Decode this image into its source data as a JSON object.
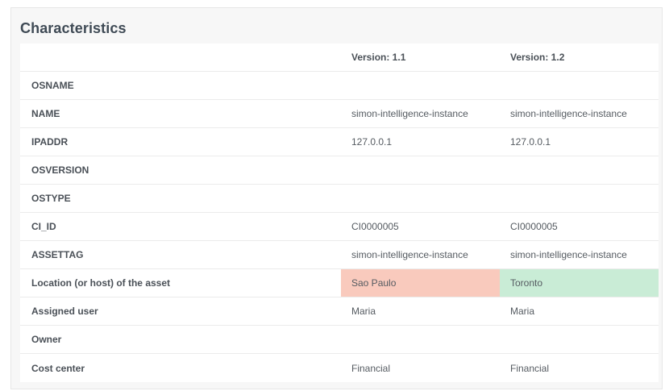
{
  "panel": {
    "title": "Characteristics"
  },
  "columns": {
    "v1": "Version: 1.1",
    "v2": "Version: 1.2"
  },
  "rows": [
    {
      "label": "OSNAME",
      "v1": "",
      "v2": ""
    },
    {
      "label": "NAME",
      "v1": "simon-intelligence-instance",
      "v2": "simon-intelligence-instance"
    },
    {
      "label": "IPADDR",
      "v1": "127.0.0.1",
      "v2": "127.0.0.1"
    },
    {
      "label": "OSVERSION",
      "v1": "",
      "v2": ""
    },
    {
      "label": "OSTYPE",
      "v1": "",
      "v2": ""
    },
    {
      "label": "CI_ID",
      "v1": "CI0000005",
      "v2": "CI0000005"
    },
    {
      "label": "ASSETTAG",
      "v1": "simon-intelligence-instance",
      "v2": "simon-intelligence-instance"
    },
    {
      "label": "Location (or host) of the asset",
      "v1": "Sao Paulo",
      "v2": "Toronto"
    },
    {
      "label": "Assigned user",
      "v1": "Maria",
      "v2": "Maria"
    },
    {
      "label": "Owner",
      "v1": "",
      "v2": ""
    },
    {
      "label": "Cost center",
      "v1": "Financial",
      "v2": "Financial"
    }
  ],
  "colors": {
    "diff_old": "#f9cabd",
    "diff_new": "#c9ecd6"
  }
}
